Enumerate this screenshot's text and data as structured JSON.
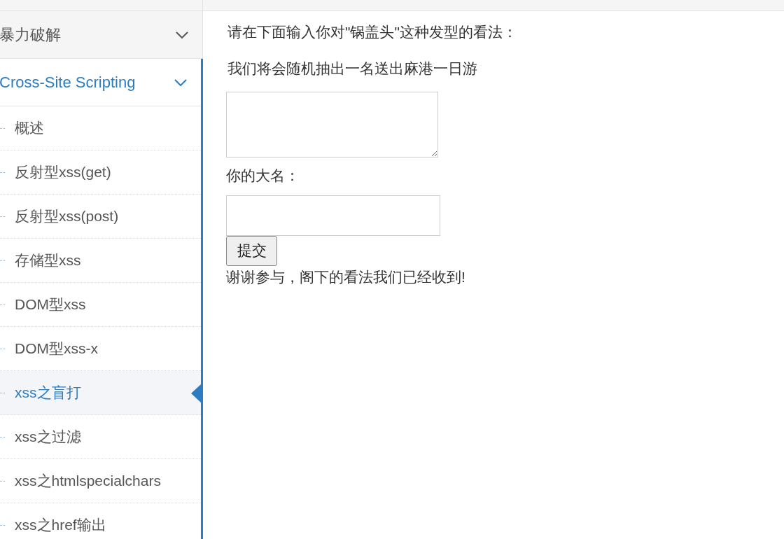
{
  "sidebar": {
    "sections": [
      {
        "label": "暴力破解",
        "selected": false
      },
      {
        "label": "Cross-Site Scripting",
        "selected": true,
        "items": [
          {
            "label": "概述",
            "selected": false
          },
          {
            "label": "反射型xss(get)",
            "selected": false
          },
          {
            "label": "反射型xss(post)",
            "selected": false
          },
          {
            "label": "存储型xss",
            "selected": false
          },
          {
            "label": "DOM型xss",
            "selected": false
          },
          {
            "label": "DOM型xss-x",
            "selected": false
          },
          {
            "label": "xss之盲打",
            "selected": true
          },
          {
            "label": "xss之过滤",
            "selected": false
          },
          {
            "label": "xss之htmlspecialchars",
            "selected": false
          },
          {
            "label": "xss之href输出",
            "selected": false
          }
        ]
      }
    ]
  },
  "main": {
    "prompt": "请在下面输入你对\"锅盖头\"这种发型的看法：",
    "notice": "我们将会随机抽出一名送出麻港一日游",
    "name_label": "你的大名：",
    "submit_button": "提交",
    "result_message": "谢谢参与，阁下的看法我们已经收到!"
  }
}
